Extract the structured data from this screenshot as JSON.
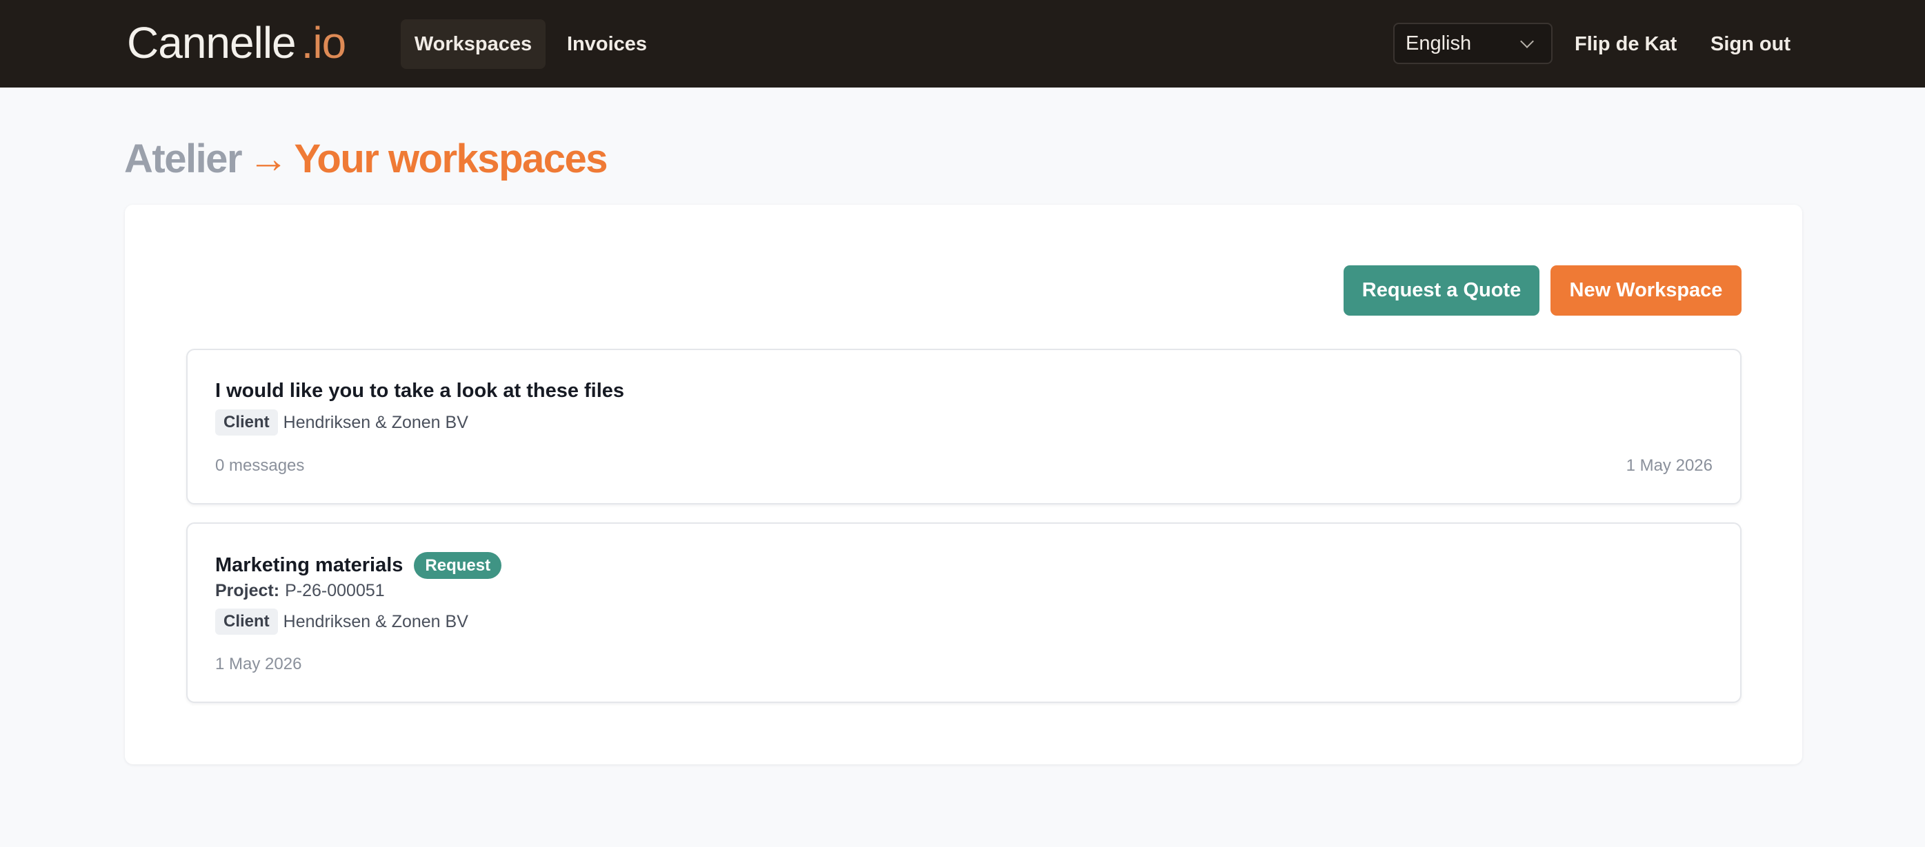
{
  "app": {
    "logo_main": "Cannelle",
    "logo_dot": ".",
    "logo_tld": "io"
  },
  "nav": {
    "items": [
      {
        "label": "Workspaces",
        "active": true
      },
      {
        "label": "Invoices",
        "active": false
      }
    ],
    "language": {
      "selected": "English"
    },
    "user_name": "Flip de Kat",
    "signout_label": "Sign out"
  },
  "breadcrumb": {
    "root": "Atelier",
    "arrow": "→",
    "current": "Your workspaces"
  },
  "actions": {
    "quote_label": "Request a Quote",
    "new_label": "New Workspace"
  },
  "workspaces": [
    {
      "title": "I would like you to take a look at these files",
      "role": "Client",
      "client_name": "Hendriksen & Zonen BV",
      "messages": "0 messages",
      "date": "1 May 2026"
    },
    {
      "title": "Marketing materials",
      "badge": "Request",
      "project_label": "Project:",
      "project_code": "P-26-000051",
      "role": "Client",
      "client_name": "Hendriksen & Zonen BV",
      "date": "1 May 2026"
    }
  ],
  "colors": {
    "topbar_bg": "#211c18",
    "accent_orange": "#ef7a35",
    "accent_teal": "#3f9484",
    "page_bg": "#f8f9fb"
  },
  "icons": {
    "language_dropdown": "chevron-down-icon"
  }
}
